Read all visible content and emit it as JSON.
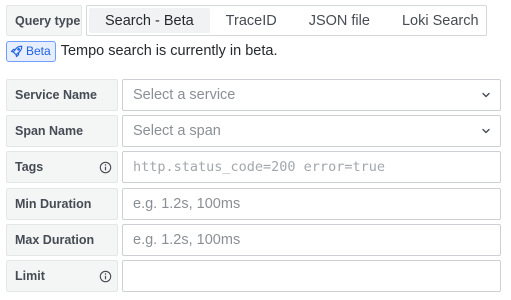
{
  "query_type": {
    "label": "Query type",
    "options": [
      {
        "label": "Search - Beta",
        "active": true
      },
      {
        "label": "TraceID",
        "active": false
      },
      {
        "label": "JSON file",
        "active": false
      },
      {
        "label": "Loki Search",
        "active": false
      }
    ]
  },
  "beta_notice": {
    "badge": "Beta",
    "text": "Tempo search is currently in beta."
  },
  "fields": {
    "service_name": {
      "label": "Service Name",
      "placeholder": "Select a service"
    },
    "span_name": {
      "label": "Span Name",
      "placeholder": "Select a span"
    },
    "tags": {
      "label": "Tags",
      "placeholder": "http.status_code=200 error=true"
    },
    "min_duration": {
      "label": "Min Duration",
      "placeholder": "e.g. 1.2s, 100ms"
    },
    "max_duration": {
      "label": "Max Duration",
      "placeholder": "e.g. 1.2s, 100ms"
    },
    "limit": {
      "label": "Limit",
      "value": ""
    }
  },
  "icons": {
    "beta_badge": "rocket-icon",
    "tags_info": "info-circle-icon",
    "limit_info": "info-circle-icon",
    "dropdown": "chevron-down-icon"
  }
}
